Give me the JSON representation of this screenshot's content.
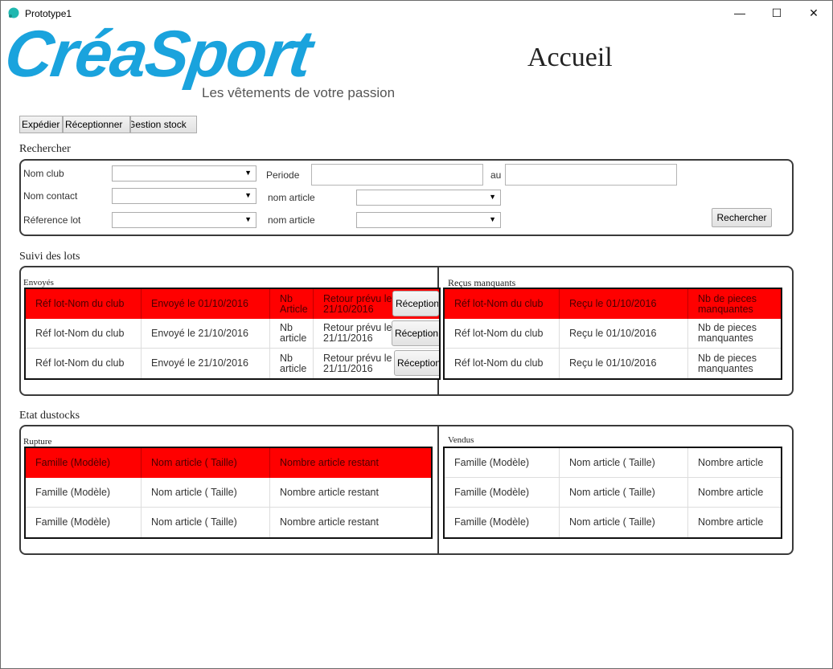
{
  "window": {
    "title": "Prototype1",
    "minimize_glyph": "—",
    "maximize_glyph": "☐",
    "close_glyph": "✕"
  },
  "logo": {
    "text": "CréaSport",
    "tagline": "Les vêtements de votre passion",
    "color": "#1aa3dd"
  },
  "page_title": "Accueil",
  "nav": {
    "expedier": "Expédier",
    "receptionner": "Réceptionner",
    "gestion_stock": "Gestion stock"
  },
  "search": {
    "title": "Rechercher",
    "nom_club": "Nom club",
    "nom_contact": "Nom contact",
    "reference_lot": "Réference lot",
    "periode": "Periode",
    "au": "au",
    "nom_article_1": "nom article",
    "nom_article_2": "nom article",
    "rechercher_button": "Rechercher",
    "dropdown_arrow": "▼"
  },
  "suivi": {
    "title": "Suivi des lots",
    "envoyes_label": "Envoyés",
    "recus_label": "Reçus manquants",
    "envoyes_rows": [
      {
        "ref": "Réf lot-Nom du club",
        "envoye": "Envoyé le 01/10/2016",
        "nb": "Nb Article",
        "retour": "Retour prévu le 21/10/2016",
        "action": "Réception"
      },
      {
        "ref": "Réf lot-Nom du club",
        "envoye": "Envoyé le 21/10/2016",
        "nb": "Nb article",
        "retour": "Retour prévu le 21/11/2016",
        "action": "Réception"
      },
      {
        "ref": "Réf lot-Nom du club",
        "envoye": "Envoyé le 21/10/2016",
        "nb": "Nb article",
        "retour": "Retour prévu le 21/11/2016",
        "action": "Réception"
      }
    ],
    "recus_rows": [
      {
        "ref": "Réf lot-Nom du club",
        "recu": "Reçu le 01/10/2016",
        "pieces": "Nb de pieces manquantes"
      },
      {
        "ref": "Réf lot-Nom du club",
        "recu": "Reçu le 01/10/2016",
        "pieces": "Nb de pieces manquantes"
      },
      {
        "ref": "Réf lot-Nom du club",
        "recu": "Reçu le 01/10/2016",
        "pieces": "Nb de pieces manquantes"
      }
    ]
  },
  "stocks": {
    "title": "Etat dustocks",
    "rupture_label": "Rupture",
    "vendus_label": "Vendus",
    "rupture_rows": [
      {
        "famille": "Famille (Modèle)",
        "article": "Nom article ( Taille)",
        "restant": "Nombre article restant"
      },
      {
        "famille": "Famille (Modèle)",
        "article": "Nom article ( Taille)",
        "restant": "Nombre article restant"
      },
      {
        "famille": "Famille (Modèle)",
        "article": "Nom article ( Taille)",
        "restant": "Nombre article restant"
      }
    ],
    "vendus_rows": [
      {
        "famille": "Famille (Modèle)",
        "article": "Nom article ( Taille)",
        "nombre": "Nombre article"
      },
      {
        "famille": "Famille (Modèle)",
        "article": "Nom article ( Taille)",
        "nombre": "Nombre article"
      },
      {
        "famille": "Famille (Modèle)",
        "article": "Nom article ( Taille)",
        "nombre": "Nombre article"
      }
    ]
  },
  "colors": {
    "highlight_row": "#ff0000",
    "logo_blue": "#1aa3dd",
    "app_icon": "#1fb8b0"
  }
}
